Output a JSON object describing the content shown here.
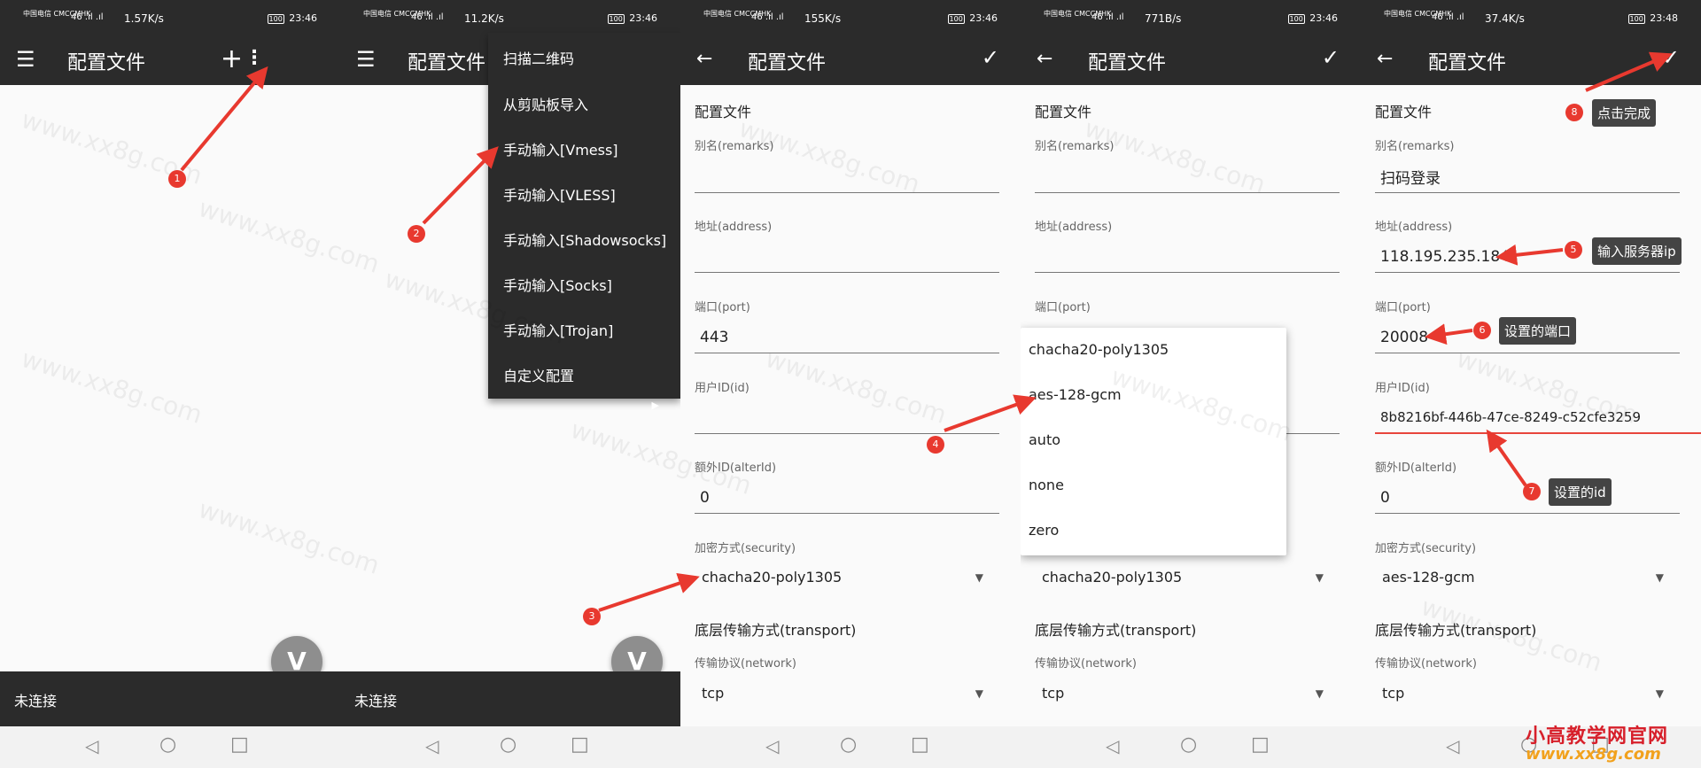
{
  "status_bar": [
    {
      "carrier": "中国电信 CMCCMHK",
      "signal": "46 .ıl .ıl",
      "speed": "1.57K/s",
      "battery": "100",
      "time": "23:46"
    },
    {
      "carrier": "中国电信 CMCCMHK",
      "signal": "46 .ıl .ıl",
      "speed": "11.2K/s",
      "battery": "100",
      "time": "23:46"
    },
    {
      "carrier": "中国电信 CMCCMHK",
      "signal": "46 .ıl .ıl",
      "speed": "155K/s",
      "battery": "100",
      "time": "23:46"
    },
    {
      "carrier": "中国电信 CMCCMHK",
      "signal": "46 .ıl .ıl",
      "speed": "771B/s",
      "battery": "100",
      "time": "23:46"
    },
    {
      "carrier": "中国电信 CMCCMHK",
      "signal": "46 .ıl .ıl",
      "speed": "37.4K/s",
      "battery": "100",
      "time": "23:48"
    }
  ],
  "app_title": "配置文件",
  "icons": {
    "menu": "☰",
    "add": "+",
    "more": "⋮",
    "back": "←",
    "check": "✓",
    "fab": "V",
    "nav_back": "◁",
    "nav_home": "○",
    "nav_recent": "□",
    "submenu_arrow": "▶",
    "dropdown_caret": "▼"
  },
  "connection_status": "未连接",
  "menu": {
    "items": [
      "扫描二维码",
      "从剪贴板导入",
      "手动输入[Vmess]",
      "手动输入[VLESS]",
      "手动输入[Shadowsocks]",
      "手动输入[Socks]",
      "手动输入[Trojan]",
      "自定义配置"
    ]
  },
  "form": {
    "section_title": "配置文件",
    "remarks_label": "别名(remarks)",
    "address_label": "地址(address)",
    "port_label": "端口(port)",
    "id_label": "用户ID(id)",
    "alterid_label": "额外ID(alterId)",
    "security_label": "加密方式(security)",
    "transport_title": "底层传输方式(transport)",
    "network_label": "传输协议(network)"
  },
  "form_values": {
    "panel3": {
      "remarks": "",
      "address": "",
      "port": "443",
      "id": "",
      "alterid": "0",
      "security": "chacha20-poly1305",
      "network": "tcp"
    },
    "panel4": {
      "security": "chacha20-poly1305",
      "network": "tcp"
    },
    "panel5": {
      "remarks": "扫码登录",
      "address": "118.195.235.184",
      "port": "20008",
      "id": "8b8216bf-446b-47ce-8249-c52cfe3259",
      "alterid": "0",
      "security": "aes-128-gcm",
      "network": "tcp"
    }
  },
  "security_dropdown": [
    "chacha20-poly1305",
    "aes-128-gcm",
    "auto",
    "none",
    "zero"
  ],
  "markers": [
    "1",
    "2",
    "3",
    "4",
    "5",
    "6",
    "7",
    "8"
  ],
  "callouts": {
    "server_ip": "输入服务器ip",
    "port": "设置的端口",
    "id": "设置的id",
    "done": "点击完成"
  },
  "watermark": "www.xx8g.com",
  "logo": {
    "title": "小高教学网官网",
    "url": "www.xx8g.com"
  },
  "colors": {
    "dark_bar": "#2b2b2b",
    "annotation_red": "#e8392f",
    "callout_bg": "#444444",
    "logo_red": "#d71f2a",
    "logo_orange": "#f2a11c"
  }
}
